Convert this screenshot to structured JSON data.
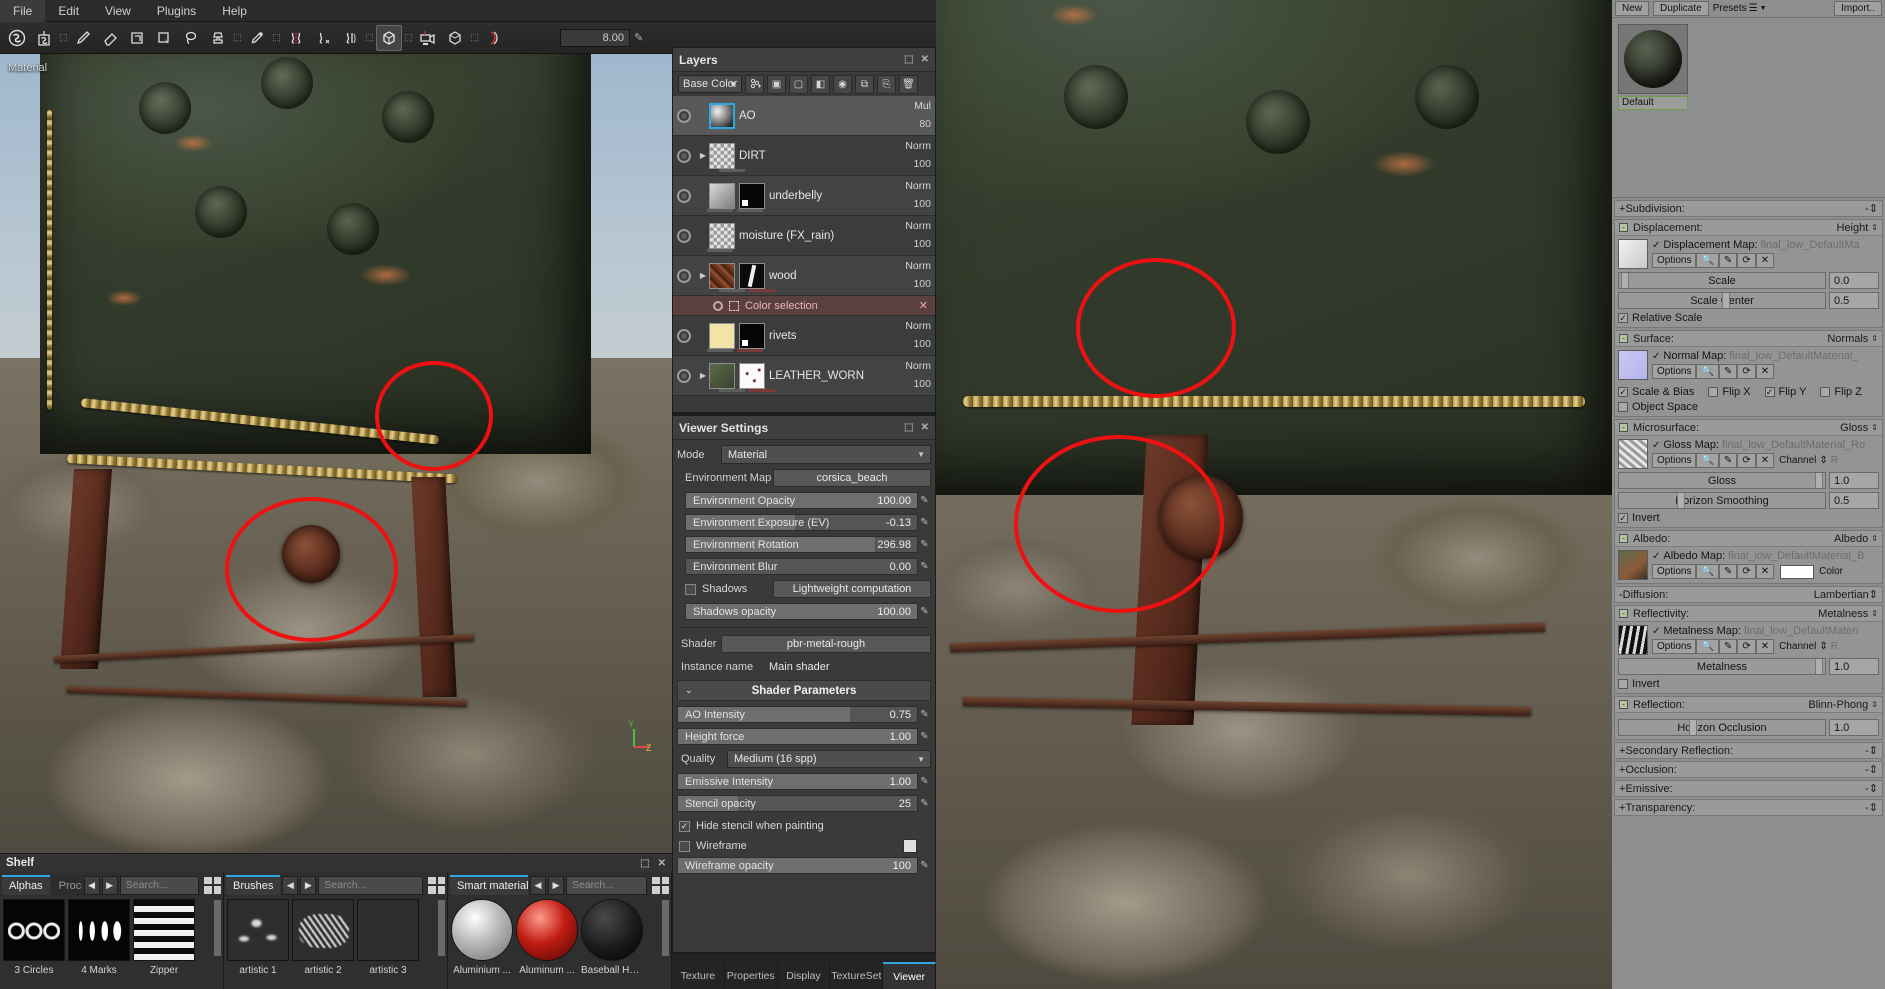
{
  "menu": {
    "items": [
      "File",
      "Edit",
      "View",
      "Plugins",
      "Help"
    ]
  },
  "toolbar": {
    "brush_size": "8.00",
    "tools": [
      {
        "name": "substance-logo-icon",
        "glyph": "S"
      },
      {
        "name": "substance-alt-icon",
        "glyph": "S"
      },
      {
        "name": "paint-brush-icon",
        "glyph": "brush"
      },
      {
        "name": "eraser-icon",
        "glyph": "eraser"
      },
      {
        "name": "projection-icon",
        "glyph": "projection"
      },
      {
        "name": "polygon-fill-icon",
        "glyph": "polyfill"
      },
      {
        "name": "lasso-icon",
        "glyph": "lasso"
      },
      {
        "name": "clone-stamp-icon",
        "glyph": "stamp"
      },
      {
        "name": "smudge-icon",
        "glyph": "smudge"
      },
      {
        "name": "symmetry-icon",
        "glyph": "symmetry"
      },
      {
        "name": "symmetry-off-icon",
        "glyph": "symmetry-x"
      },
      {
        "name": "mirror-icon",
        "glyph": "mirror"
      },
      {
        "name": "bake-cube-icon",
        "glyph": "cube"
      },
      {
        "name": "camera-icon",
        "glyph": "camera"
      },
      {
        "name": "geometry-cube-icon",
        "glyph": "cube2"
      },
      {
        "name": "curvature-icon",
        "glyph": "curve"
      }
    ]
  },
  "viewport": {
    "left_label": "Material",
    "axis_labels": [
      "Y",
      "Z"
    ]
  },
  "layers": {
    "title": "Layers",
    "channel_selector": "Base Color",
    "toolbar_icons": [
      "add-layer-icon",
      "add-fill-layer-icon",
      "add-folder-icon",
      "add-mask-icon",
      "add-effect-icon",
      "layer-instance-icon",
      "duplicate-layer-icon",
      "delete-layer-icon"
    ],
    "rows": [
      {
        "name": "AO",
        "blend": "Mul",
        "opacity": "80",
        "selected": true,
        "folder": false,
        "thumb": "ao"
      },
      {
        "name": "DIRT",
        "blend": "Norm",
        "opacity": "100",
        "selected": false,
        "folder": true,
        "thumb": "checker"
      },
      {
        "name": "underbelly",
        "blend": "Norm",
        "opacity": "100",
        "selected": false,
        "folder": false,
        "thumb": "grey",
        "mask": "black"
      },
      {
        "name": "moisture (FX_rain)",
        "blend": "Norm",
        "opacity": "100",
        "selected": false,
        "folder": false,
        "thumb": "checker"
      },
      {
        "name": "wood",
        "blend": "Norm",
        "opacity": "100",
        "selected": false,
        "folder": true,
        "thumb": "wood",
        "mask": "mask"
      },
      {
        "name": "rivets",
        "blend": "Norm",
        "opacity": "100",
        "selected": false,
        "folder": false,
        "thumb": "cream",
        "mask": "black"
      },
      {
        "name": "LEATHER_WORN",
        "blend": "Norm",
        "opacity": "100",
        "selected": false,
        "folder": true,
        "thumb": "green",
        "mask": "whitenoise"
      }
    ],
    "color_selection_label": "Color selection"
  },
  "viewer_settings": {
    "title": "Viewer Settings",
    "mode_label": "Mode",
    "mode_value": "Material",
    "environment_map_label": "Environment Map",
    "environment_map_value": "corsica_beach",
    "sliders": [
      {
        "label": "Environment Opacity",
        "value": "100.00",
        "fill": 100
      },
      {
        "label": "Environment Exposure (EV)",
        "value": "-0.13",
        "fill": 47
      },
      {
        "label": "Environment Rotation",
        "value": "296.98",
        "fill": 82
      },
      {
        "label": "Environment Blur",
        "value": "0.00",
        "fill": 0
      }
    ],
    "shadows_label": "Shadows",
    "shadows_value": "Lightweight computation",
    "shadows_opacity_label": "Shadows opacity",
    "shadows_opacity_value": "100.00",
    "shader_label": "Shader",
    "shader_value": "pbr-metal-rough",
    "instance_name_label": "Instance name",
    "instance_name_value": "Main shader",
    "shader_params_title": "Shader Parameters",
    "params": [
      {
        "label": "AO Intensity",
        "value": "0.75",
        "fill": 72
      },
      {
        "label": "Height force",
        "value": "1.00",
        "fill": 100
      },
      {
        "label": "Quality",
        "value": "Medium (16 spp)",
        "combo": true
      },
      {
        "label": "Emissive Intensity",
        "value": "1.00",
        "fill": 100
      },
      {
        "label": "Stencil opacity",
        "value": "25",
        "fill": 25
      }
    ],
    "hide_stencil_label": "Hide stencil when painting",
    "wireframe_label": "Wireframe",
    "wireframe_opacity_label": "Wireframe opacity",
    "wireframe_opacity_value": "100",
    "tabs": [
      {
        "label": "Texture",
        "active": false
      },
      {
        "label": "Properties",
        "active": false
      },
      {
        "label": "Display",
        "active": false
      },
      {
        "label": "TextureSet",
        "active": false
      },
      {
        "label": "Viewer",
        "active": true
      }
    ]
  },
  "right_panel": {
    "buttons": {
      "new": "New",
      "duplicate": "Duplicate",
      "presets": "Presets",
      "import": "Import.."
    },
    "material_name": "Default",
    "groups": [
      {
        "name": "Subdivision:",
        "value": "-",
        "collapsed": true,
        "expander": "+"
      },
      {
        "name": "Displacement:",
        "value": "Height",
        "collapsed": false,
        "expander": "-",
        "map_label": "Displacement Map:",
        "map_value": "final_low_DefaultMa",
        "options_label": "Options",
        "sliders": [
          {
            "label": "Scale",
            "value": "0.0"
          },
          {
            "label": "Scale Center",
            "value": "0.5"
          }
        ],
        "checks": [
          {
            "label": "Relative Scale",
            "on": true
          }
        ]
      },
      {
        "name": "Surface:",
        "value": "Normals",
        "collapsed": false,
        "expander": "-",
        "map_label": "Normal Map:",
        "map_value": "final_low_DefaultMaterial_",
        "options_label": "Options",
        "checks": [
          {
            "label": "Scale & Bias",
            "on": true
          },
          {
            "label": "Flip X",
            "on": false
          },
          {
            "label": "Flip Y",
            "on": true
          },
          {
            "label": "Flip Z",
            "on": false
          },
          {
            "label": "Object Space",
            "on": false
          }
        ]
      },
      {
        "name": "Microsurface:",
        "value": "Gloss",
        "collapsed": false,
        "expander": "-",
        "map_label": "Gloss Map:",
        "map_value": "final_low_DefaultMaterial_Ro",
        "options_label": "Options",
        "channel_label": "Channel",
        "channel_value": "R",
        "sliders": [
          {
            "label": "Gloss",
            "value": "1.0"
          },
          {
            "label": "Horizon Smoothing",
            "value": "0.5"
          }
        ],
        "checks": [
          {
            "label": "Invert",
            "on": true
          }
        ]
      },
      {
        "name": "Albedo:",
        "value": "Albedo",
        "collapsed": false,
        "expander": "-",
        "map_label": "Albedo Map:",
        "map_value": "final_low_DefaultMaterial_B",
        "options_label": "Options",
        "color_label": "Color"
      },
      {
        "name": "Diffusion:",
        "value": "Lambertian",
        "collapsed": true,
        "expander": "-"
      },
      {
        "name": "Reflectivity:",
        "value": "Metalness",
        "collapsed": false,
        "expander": "-",
        "map_label": "Metalness Map:",
        "map_value": "final_low_DefaultMateri",
        "options_label": "Options",
        "channel_label": "Channel",
        "channel_value": "R",
        "sliders": [
          {
            "label": "Metalness",
            "value": "1.0"
          }
        ],
        "checks": [
          {
            "label": "Invert",
            "on": false
          }
        ]
      },
      {
        "name": "Reflection:",
        "value": "Blinn-Phong",
        "collapsed": false,
        "expander": "-",
        "sliders": [
          {
            "label": "Horizon Occlusion",
            "value": "1.0"
          }
        ]
      },
      {
        "name": "Secondary Reflection:",
        "value": "-",
        "collapsed": true,
        "expander": "+"
      },
      {
        "name": "Occlusion:",
        "value": "-",
        "collapsed": true,
        "expander": "+"
      },
      {
        "name": "Emissive:",
        "value": "-",
        "collapsed": true,
        "expander": "+"
      },
      {
        "name": "Transparency:",
        "value": "-",
        "collapsed": true,
        "expander": "+"
      }
    ]
  },
  "shelf": {
    "title": "Shelf",
    "columns": [
      {
        "tabs": [
          {
            "label": "Alphas",
            "active": true
          },
          {
            "label": "Procedurals",
            "active": false
          }
        ],
        "search_placeholder": "Search...",
        "items": [
          {
            "label": "3 Circles",
            "thumb": "t-circles"
          },
          {
            "label": "4 Marks",
            "thumb": "t-marks"
          },
          {
            "label": "Zipper",
            "thumb": "t-zipper"
          }
        ]
      },
      {
        "tabs": [
          {
            "label": "Brushes",
            "active": true
          }
        ],
        "search_placeholder": "Search...",
        "items": [
          {
            "label": "artistic 1",
            "thumb": "t-brush1"
          },
          {
            "label": "artistic 2",
            "thumb": "t-brush2"
          },
          {
            "label": "artistic 3",
            "thumb": "t-brush3"
          }
        ]
      },
      {
        "tabs": [
          {
            "label": "Smart materials",
            "active": true
          }
        ],
        "search_placeholder": "Search...",
        "items": [
          {
            "label": "Aluminium ...",
            "thumb": "t-alu"
          },
          {
            "label": "Aluminum ...",
            "thumb": "t-alu2"
          },
          {
            "label": "Baseball Hat...",
            "thumb": "t-base"
          }
        ]
      }
    ]
  }
}
